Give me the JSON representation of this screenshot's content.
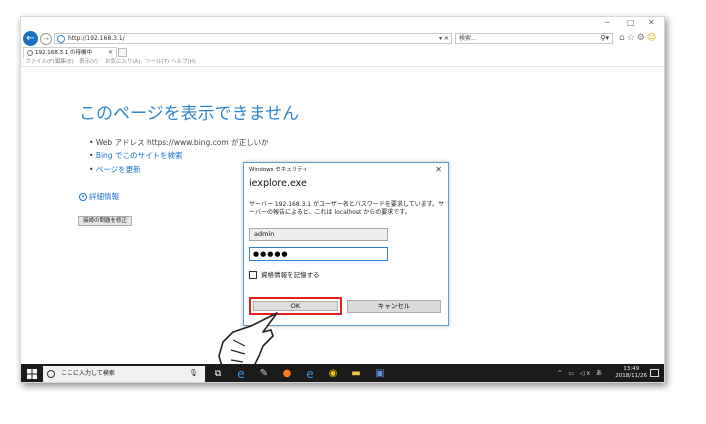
{
  "browser": {
    "address_url": "http://192.168.3.1/",
    "search_placeholder": "検索...",
    "tab_title": "192.168.3.1 の待機中",
    "menus": [
      "ファイル(F)",
      "編集(E)",
      "表示(V)",
      "お気に入り(A)",
      "ツール(T)",
      "ヘルプ(H)"
    ]
  },
  "error_page": {
    "title": "このページを表示できません",
    "bullet1_prefix": "Web アドレス https://www.bing.com が正しいか",
    "bullet2": "Bing でこのサイトを検索",
    "bullet3": "ページを更新",
    "details": "詳細情報",
    "fix_button": "接続の問題を修正"
  },
  "dialog": {
    "window_title": "Windows セキュリティ",
    "app_name": "iexplore.exe",
    "message": "サーバー 192.168.3.1 がユーザー名とパスワードを要求しています。サーバーの報告によると、これは localhost からの要求です。",
    "username_value": "admin",
    "password_mask": "●●●●●",
    "remember_label": "資格情報を記憶する",
    "ok_label": "OK",
    "cancel_label": "キャンセル"
  },
  "taskbar": {
    "search_placeholder": "ここに入力して検索",
    "time": "13:49",
    "date": "2018/11/26"
  },
  "colors": {
    "accent": "#2f85cc",
    "highlight": "#e02020",
    "taskbar": "#1b1b1b"
  }
}
